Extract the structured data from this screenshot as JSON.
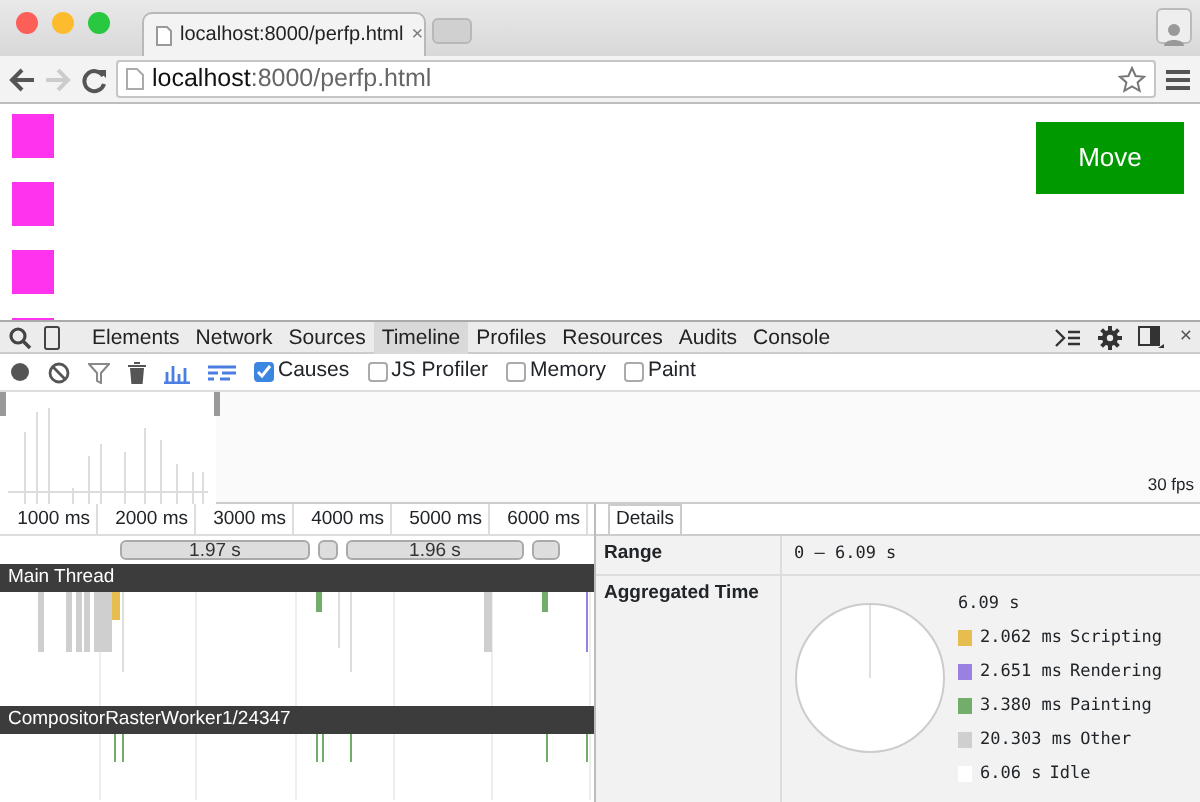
{
  "browser": {
    "tab_title": "localhost:8000/perfp.html",
    "tab_close": "×",
    "address_host": "localhost",
    "address_rest": ":8000/perfp.html"
  },
  "page": {
    "button": "Move"
  },
  "devtools": {
    "tabs": [
      {
        "label": "Elements",
        "selected": false
      },
      {
        "label": "Network",
        "selected": false
      },
      {
        "label": "Sources",
        "selected": false
      },
      {
        "label": "Timeline",
        "selected": true
      },
      {
        "label": "Profiles",
        "selected": false
      },
      {
        "label": "Resources",
        "selected": false
      },
      {
        "label": "Audits",
        "selected": false
      },
      {
        "label": "Console",
        "selected": false
      }
    ],
    "close": "×",
    "options": [
      {
        "label": "Causes",
        "checked": true
      },
      {
        "label": "JS Profiler",
        "checked": false
      },
      {
        "label": "Memory",
        "checked": false
      },
      {
        "label": "Paint",
        "checked": false
      }
    ],
    "overview": {
      "fps": "30 fps"
    },
    "ruler": [
      "1000 ms",
      "2000 ms",
      "3000 ms",
      "4000 ms",
      "5000 ms",
      "6000 ms"
    ],
    "ranges": [
      "1.97 s",
      "1.96 s"
    ],
    "threads": [
      "Main Thread",
      "CompositorRasterWorker1/24347"
    ],
    "details": {
      "tab": "Details",
      "range_label": "Range",
      "range_value": "0 – 6.09 s",
      "aggregated_label": "Aggregated Time",
      "total": "6.09 s",
      "legend": [
        {
          "value": "2.062 ms",
          "label": "Scripting",
          "color": "#e8bd50"
        },
        {
          "value": "2.651 ms",
          "label": "Rendering",
          "color": "#9a80e0"
        },
        {
          "value": "3.380 ms",
          "label": "Painting",
          "color": "#72ad6b"
        },
        {
          "value": "20.303 ms",
          "label": "Other",
          "color": "#cfcfcf"
        },
        {
          "value": "6.06 s",
          "label": "Idle",
          "color": "#ffffff"
        }
      ]
    }
  }
}
